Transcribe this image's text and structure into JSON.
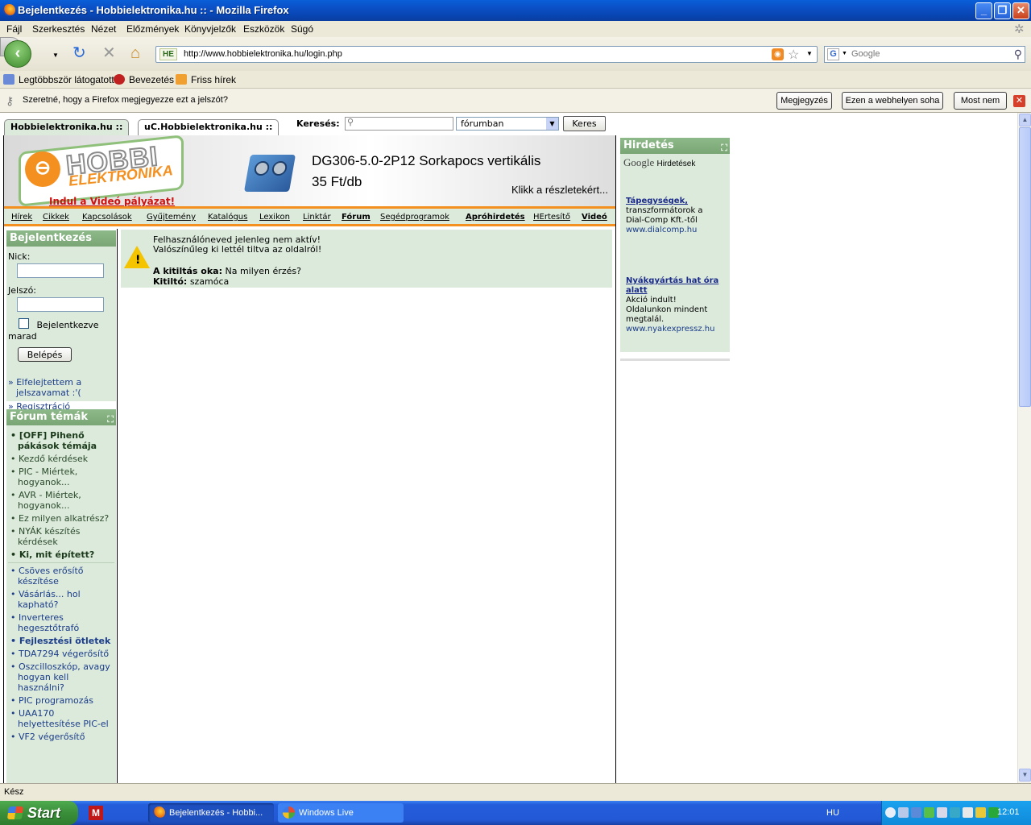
{
  "window": {
    "title": "Bejelentkezés - Hobbielektronika.hu :: - Mozilla Firefox"
  },
  "menu": [
    "Fájl",
    "Szerkesztés",
    "Nézet",
    "Előzmények",
    "Könyvjelzők",
    "Eszközök",
    "Súgó"
  ],
  "nav": {
    "url": "http://www.hobbielektronika.hu/login.php",
    "site_badge": "HE",
    "search_placeholder": "Google",
    "search_engine_letter": "G"
  },
  "bookmarks": [
    "Legtöbbször látogatott",
    "Bevezetés",
    "Friss hírek"
  ],
  "password_bar": {
    "text": "Szeretné, hogy a Firefox megjegyezze ezt a jelszót?",
    "buttons": [
      "Megjegyzés",
      "Ezen a webhelyen soha",
      "Most nem"
    ]
  },
  "site": {
    "tabs": [
      "Hobbielektronika.hu ::",
      "uC.Hobbielektronika.hu ::"
    ],
    "search_label": "Keresés:",
    "search_scope": "fórumban",
    "search_button": "Keres",
    "logo_main": "HOBBI",
    "logo_sub": "ELEKTRONIKA",
    "video_link": "Indul a Videó pályázat!",
    "product_title": "DG306-5.0-2P12 Sorkapocs vertikális",
    "product_price": "35 Ft/db",
    "product_more": "Klikk a részletekért...",
    "top_nav": [
      {
        "label": "Hírek",
        "bold": false
      },
      {
        "label": "Cikkek",
        "bold": false
      },
      {
        "label": "Kapcsolások",
        "bold": false
      },
      {
        "label": "Gyűjtemény",
        "bold": false
      },
      {
        "label": "Katalógus",
        "bold": false
      },
      {
        "label": "Lexikon",
        "bold": false
      },
      {
        "label": "Linktár",
        "bold": false
      },
      {
        "label": "Fórum",
        "bold": true
      },
      {
        "label": "Segédprogramok",
        "bold": false
      },
      {
        "label": "Apróhirdetés",
        "bold": true
      },
      {
        "label": "HErtesítő",
        "bold": false
      },
      {
        "label": "Videó",
        "bold": true
      }
    ]
  },
  "login": {
    "title": "Bejelentkezés",
    "nick_label": "Nick:",
    "password_label": "Jelszó:",
    "remember_label": "Bejelentkezve marad",
    "submit": "Belépés",
    "forgot": "Elfelejtettem a jelszavamat :'(",
    "register": "Regisztráció"
  },
  "forum": {
    "title": "Fórum témák",
    "group1": [
      {
        "label": "[OFF] Pihenő pákások témája",
        "bold": true
      },
      {
        "label": "Kezdő kérdések",
        "bold": false
      },
      {
        "label": "PIC - Miértek, hogyanok...",
        "bold": false
      },
      {
        "label": "AVR - Miértek, hogyanok...",
        "bold": false
      },
      {
        "label": "Ez milyen alkatrész?",
        "bold": false
      },
      {
        "label": "NYÁK készítés kérdések",
        "bold": false
      },
      {
        "label": "Ki, mit épített?",
        "bold": true
      }
    ],
    "group2": [
      {
        "label": "Csöves erősítő készítése",
        "bold": false
      },
      {
        "label": "Vásárlás... hol kapható?",
        "bold": false
      },
      {
        "label": "Inverteres hegesztőtrafó",
        "bold": false
      },
      {
        "label": "Fejlesztési ötletek",
        "bold": true
      },
      {
        "label": "TDA7294 végerősítő",
        "bold": false
      },
      {
        "label": "Oszcilloszkóp, avagy hogyan kell használni?",
        "bold": false
      },
      {
        "label": "PIC programozás",
        "bold": false
      },
      {
        "label": "UAA170 helyettesítése PIC-el",
        "bold": false
      },
      {
        "label": "VF2 végerősítő",
        "bold": false
      }
    ]
  },
  "warning": {
    "line1": "Felhasználóneved jelenleg nem aktív!",
    "line2": "Valószínűleg ki lettél tiltva az oldalról!",
    "reason_label": "A kitiltás oka:",
    "reason": "Na milyen érzés?",
    "banner_label": "Kitiltó:",
    "banner": "szamóca"
  },
  "ads": {
    "title": "Hirdetés",
    "google": "Google",
    "google_sub": "Hirdetések",
    "items": [
      {
        "headline": "Tápegységek,",
        "body": "transzformátorok a Dial-Comp Kft.-től",
        "url": "www.dialcomp.hu"
      },
      {
        "headline": "Nyákgyártás hat óra alatt",
        "body": "Akció indult! Oldalunkon mindent megtalál.",
        "url": "www.nyakexpressz.hu"
      }
    ]
  },
  "status": "Kész",
  "taskbar": {
    "start": "Start",
    "tasks": [
      "Bejelentkezés - Hobbi...",
      "Windows Live"
    ],
    "lang": "HU",
    "clock": "12:01"
  }
}
